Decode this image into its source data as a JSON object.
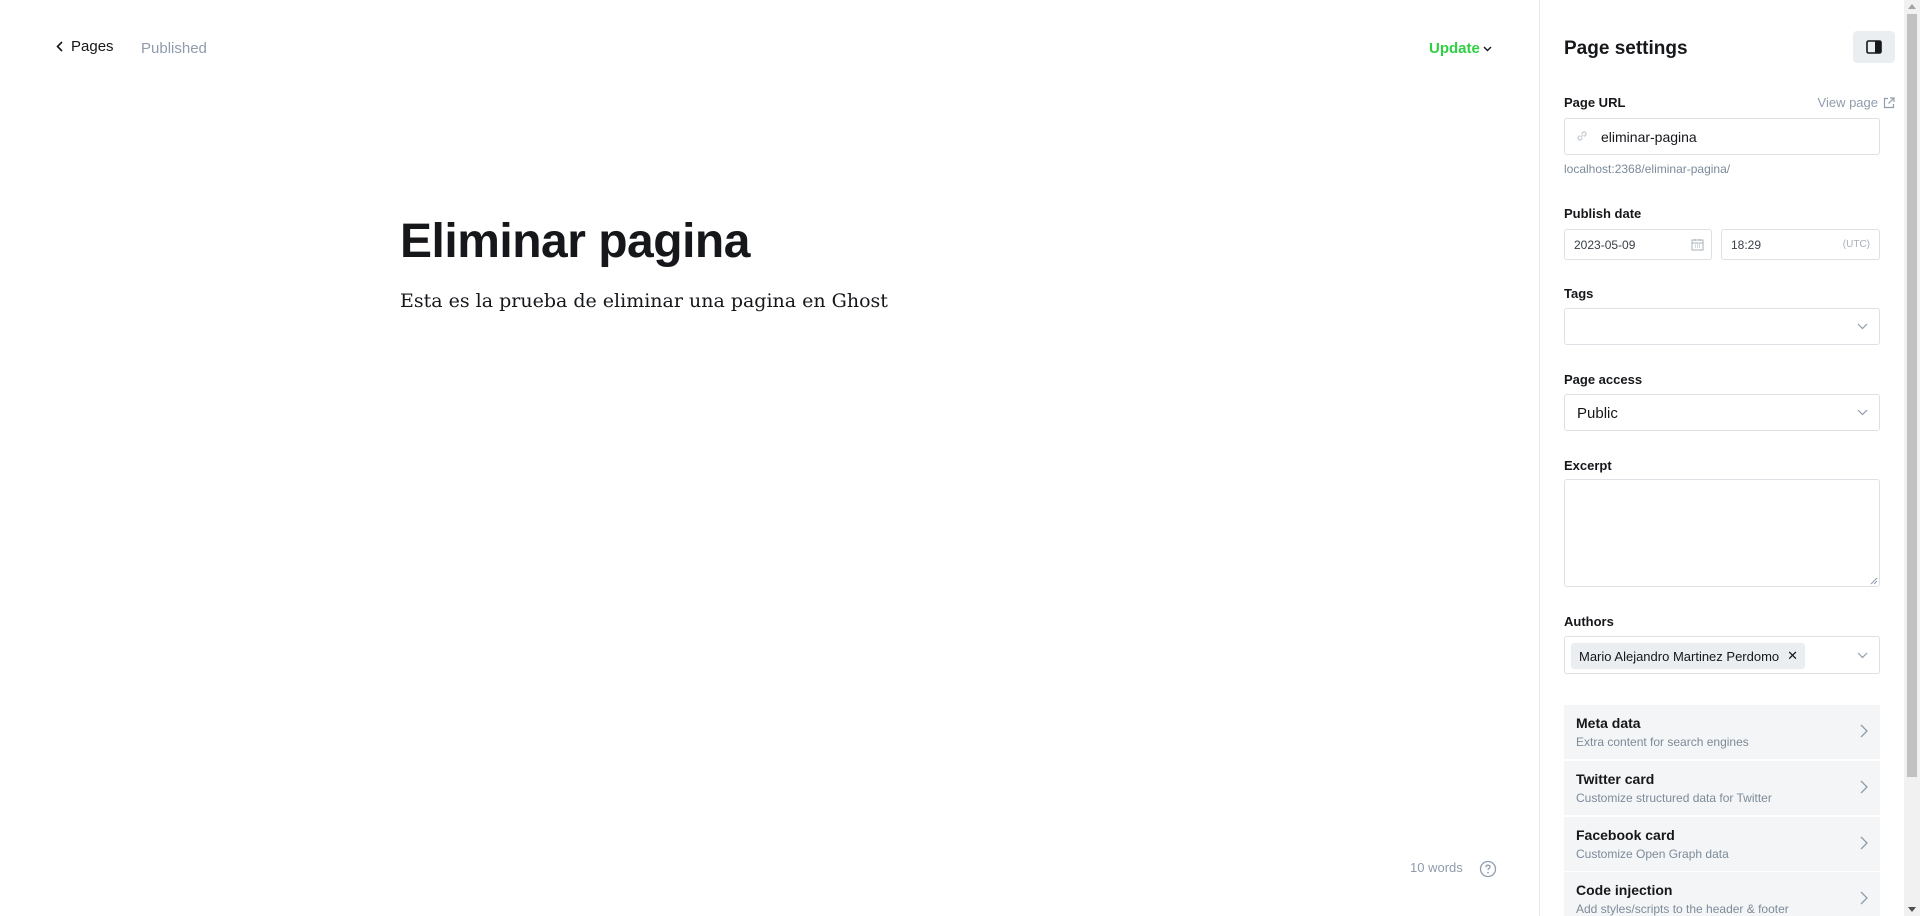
{
  "header": {
    "back_label": "Pages",
    "status": "Published",
    "update_label": "Update"
  },
  "editor": {
    "title": "Eliminar pagina",
    "body": "Esta es la prueba de eliminar una pagina en Ghost",
    "word_count": "10 words"
  },
  "settings": {
    "title": "Page settings",
    "page_url_label": "Page URL",
    "view_page_label": "View page",
    "page_url_value": "eliminar-pagina",
    "page_url_hint": "localhost:2368/eliminar-pagina/",
    "publish_date_label": "Publish date",
    "publish_date": "2023-05-09",
    "publish_time": "18:29",
    "timezone": "(UTC)",
    "tags_label": "Tags",
    "tags_value": "",
    "access_label": "Page access",
    "access_value": "Public",
    "excerpt_label": "Excerpt",
    "excerpt_value": "",
    "authors_label": "Authors",
    "authors": [
      "Mario Alejandro Martinez Perdomo"
    ],
    "sections": [
      {
        "title": "Meta data",
        "subtitle": "Extra content for search engines"
      },
      {
        "title": "Twitter card",
        "subtitle": "Customize structured data for Twitter"
      },
      {
        "title": "Facebook card",
        "subtitle": "Customize Open Graph data"
      },
      {
        "title": "Code injection",
        "subtitle": "Add styles/scripts to the header & footer"
      }
    ]
  },
  "colors": {
    "accent_green": "#30cf43",
    "muted_text": "#8e9cac"
  }
}
